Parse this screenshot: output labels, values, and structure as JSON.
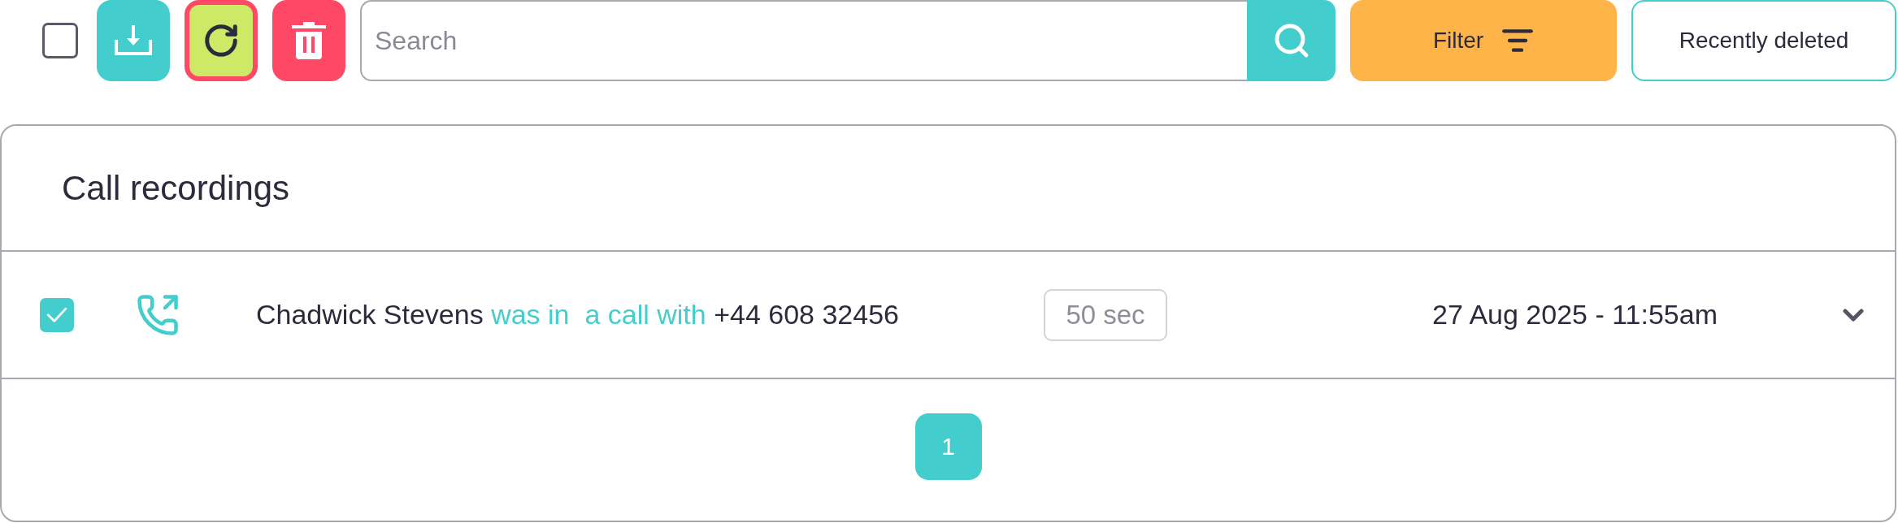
{
  "toolbar": {
    "select_all": {
      "checked": false
    },
    "actions": [
      {
        "kind": "download",
        "focused": false
      },
      {
        "kind": "refresh",
        "focused": true
      },
      {
        "kind": "delete",
        "focused": false
      }
    ],
    "search": {
      "placeholder": "Search"
    },
    "filter_button": {
      "label": "Filter"
    },
    "recently_deleted_button": {
      "label": "Recently deleted"
    }
  },
  "recordings_panel": {
    "title": "Call recordings",
    "rows": [
      {
        "checked": true,
        "caller": "Chadwick Stevens",
        "action": "was in  a call with",
        "callee": "+44 608 32456",
        "duration": "50 sec",
        "datetime": "27 Aug 2025 - 11:55am",
        "expanded": false
      }
    ],
    "pagination": [
      {
        "label": "1",
        "selected": true
      }
    ]
  }
}
